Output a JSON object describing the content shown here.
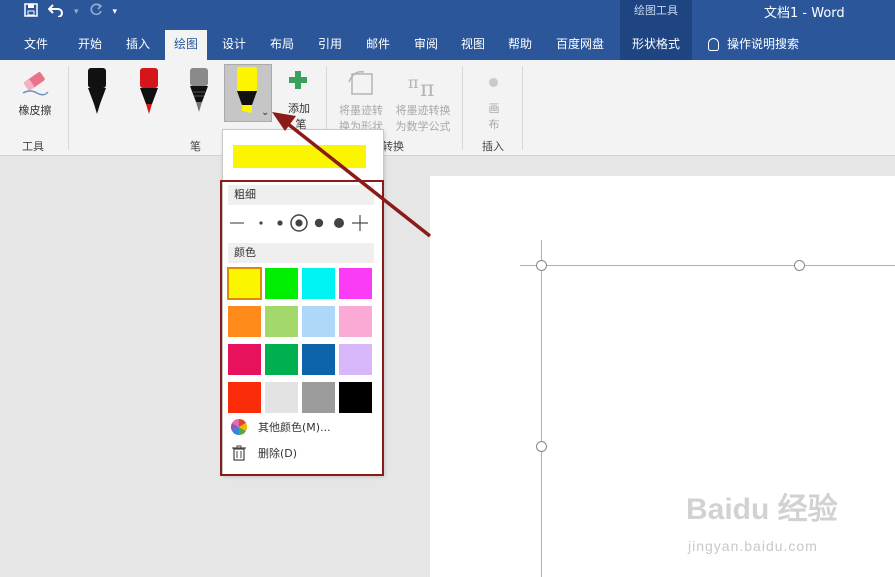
{
  "title_bar": {
    "context_group": "绘图工具",
    "doc_title": "文档1  -  Word"
  },
  "tabs": [
    "文件",
    "开始",
    "插入",
    "绘图",
    "设计",
    "布局",
    "引用",
    "邮件",
    "审阅",
    "视图",
    "帮助",
    "百度网盘",
    "形状格式"
  ],
  "active_tab": "绘图",
  "tell_me": "操作说明搜索",
  "ribbon": {
    "eraser_label": "橡皮擦",
    "group_tools": "工具",
    "group_pens": "笔",
    "add_pen_line1": "添加",
    "add_pen_line2": "笔",
    "convert_shape_line1": "将墨迹转",
    "convert_shape_line2": "换为形状",
    "convert_math_line1": "将墨迹转换",
    "convert_math_line2": "为数学公式",
    "group_convert": "转换",
    "canvas_line1": "画",
    "canvas_line2": "布",
    "group_insert": "插入"
  },
  "dropdown": {
    "thickness_label": "粗细",
    "color_label": "颜色",
    "selected_color": "#fbf500",
    "colors": [
      [
        "#fbf500",
        "#00ee00",
        "#00f3f3",
        "#fa3cf6"
      ],
      [
        "#ff8a1c",
        "#a3d86a",
        "#aed7fa",
        "#fba9d5"
      ],
      [
        "#e8125c",
        "#00b050",
        "#0c65ab",
        "#d7b6fa"
      ],
      [
        "#fa2c0a",
        "#e3e3e3",
        "#9b9b9b",
        "#000000"
      ]
    ],
    "more_colors": "其他颜色(M)...",
    "delete": "删除(D)"
  },
  "watermark": {
    "brand": "Baidu 经验",
    "url": "jingyan.baidu.com"
  }
}
